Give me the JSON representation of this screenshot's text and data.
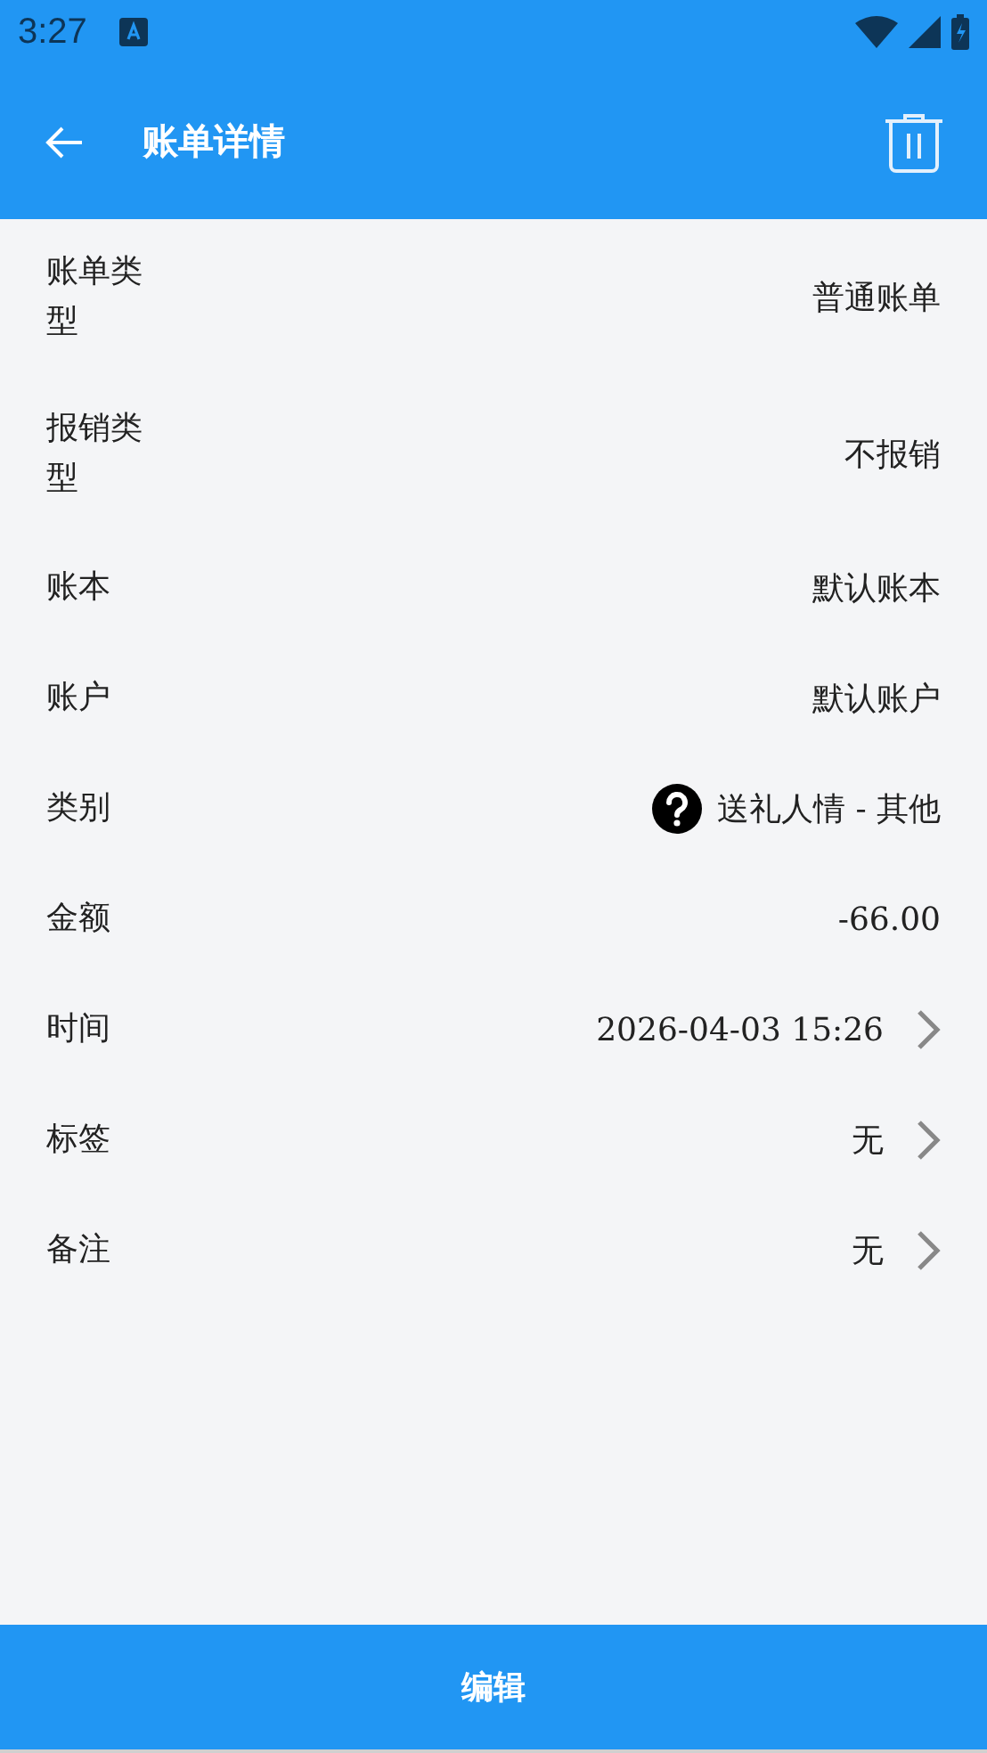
{
  "status_bar": {
    "time": "3:27"
  },
  "app_bar": {
    "title": "账单详情"
  },
  "rows": [
    {
      "label": "账单类型",
      "value": "普通账单",
      "kind": "text"
    },
    {
      "label": "报销类型",
      "value": "不报销",
      "kind": "text"
    },
    {
      "label": "账本",
      "value": "默认账本",
      "kind": "text"
    },
    {
      "label": "账户",
      "value": "默认账户",
      "kind": "text"
    },
    {
      "label": "类别",
      "value": "送礼人情 - 其他",
      "kind": "category"
    },
    {
      "label": "金额",
      "value": "-66.00",
      "kind": "text"
    },
    {
      "label": "时间",
      "value": "2026-04-03 15:26",
      "kind": "link"
    },
    {
      "label": "标签",
      "value": "无",
      "kind": "link"
    },
    {
      "label": "备注",
      "value": "无",
      "kind": "link"
    }
  ],
  "bottom_button": {
    "label": "编辑"
  }
}
